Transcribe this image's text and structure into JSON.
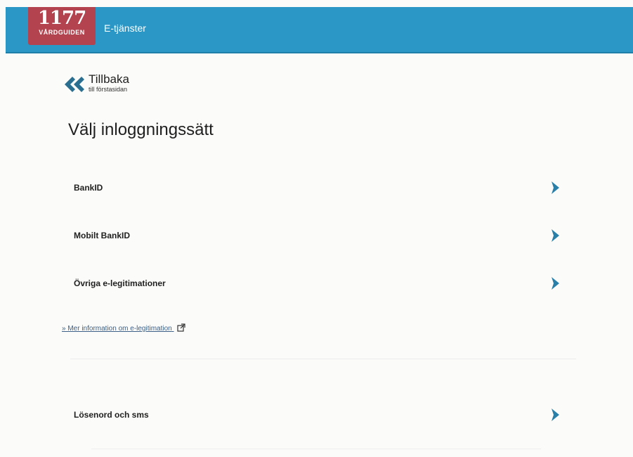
{
  "header": {
    "logo_number": "1177",
    "logo_sub": "VÅRDGUIDEN",
    "title": "E-tjänster"
  },
  "back_link": {
    "title": "Tillbaka",
    "subtitle": "till förstasidan"
  },
  "page_title": "Välj inloggningssätt",
  "options": [
    {
      "label": "BankID"
    },
    {
      "label": "Mobilt BankID"
    },
    {
      "label": "Övriga e-legitimationer"
    },
    {
      "label": "Lösenord och sms"
    }
  ],
  "info_link": {
    "text": "» Mer information om e-legitimation"
  },
  "colors": {
    "header_bg": "#2a97c6",
    "logo_bg": "#b3434f",
    "chevron": "#2a7fa8",
    "back_chevron": "#2a6f8f"
  },
  "icons": {
    "back": "double-chevron-left-icon",
    "option_arrow": "chevron-right-icon",
    "external": "external-link-icon"
  }
}
